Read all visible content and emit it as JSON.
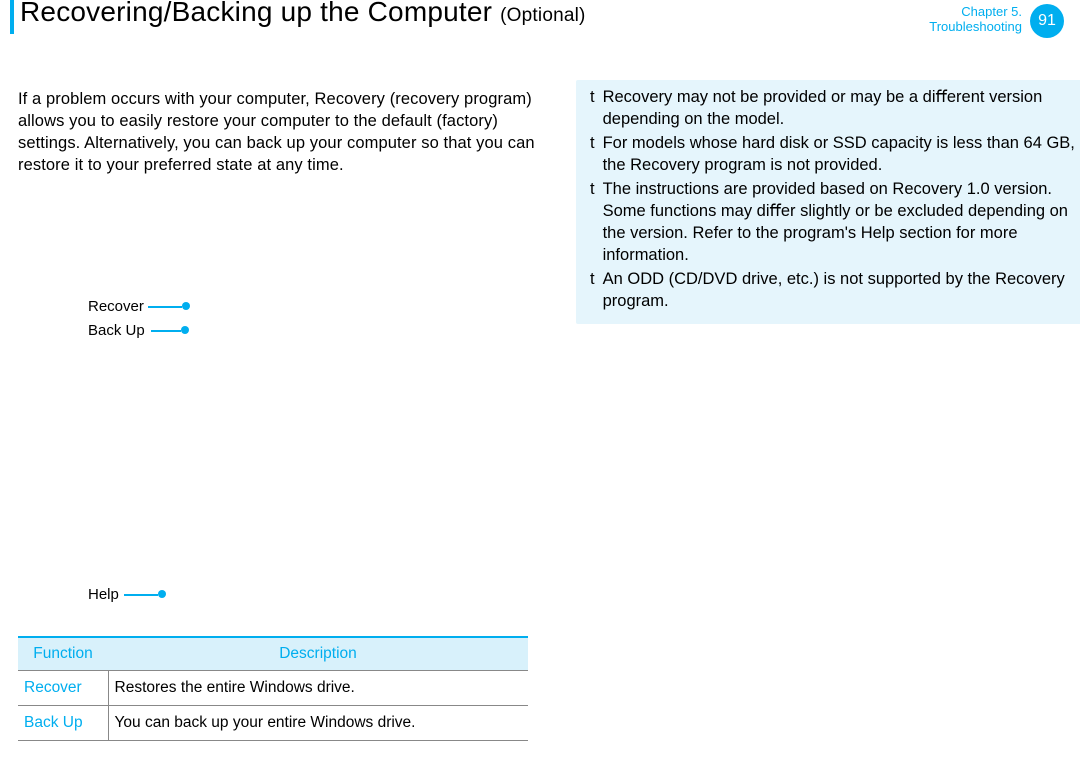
{
  "header": {
    "title_main": "Recovering/Backing up the Computer ",
    "title_sub": "(Optional)",
    "chapter_line1": "Chapter 5.",
    "chapter_line2": "Troubleshooting",
    "page_number": "91"
  },
  "intro_paragraph": "If a problem occurs with your computer, Recovery (recovery program) allows you to easily restore your computer to the default (factory) settings. Alternatively, you can back up your computer so that you can restore it to your preferred state at any time.",
  "callouts": {
    "recover": "Recover",
    "backup": "Back Up",
    "help": "Help"
  },
  "table": {
    "headers": {
      "function": "Function",
      "description": "Description"
    },
    "rows": [
      {
        "function": "Recover",
        "description": "Restores the entire Windows drive."
      },
      {
        "function": "Back Up",
        "description": "You can back up your entire Windows drive."
      }
    ]
  },
  "note_bullet": "t",
  "notes": [
    "Recovery may not be provided or may be a diﬀerent version depending on the model.",
    "For models whose hard disk or SSD capacity is less than 64 GB, the Recovery program is not provided.",
    "The instructions are provided based on Recovery 1.0 version. Some functions may diﬀer slightly or be excluded depending on the version. Refer to the program's Help section for more information.",
    "An ODD (CD/DVD drive, etc.) is not supported by the Recovery program."
  ]
}
